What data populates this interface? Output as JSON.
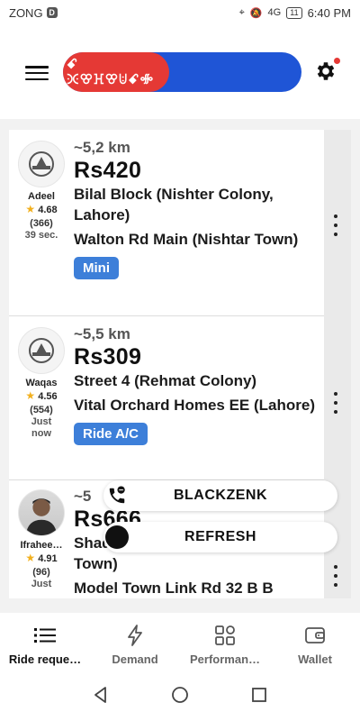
{
  "status_bar": {
    "carrier": "ZONG",
    "carrier_badge": "D",
    "network": "4G",
    "battery": "11",
    "time": "6:40 PM"
  },
  "header": {
    "status_text": "ꗃ ꖻꕢꖾꕢꖹꗃꗂ"
  },
  "rides": [
    {
      "driver_name": "Adeel",
      "rating": "4.68",
      "rating_count": "(366)",
      "time_ago": "39 sec.",
      "distance": "~5,2 km",
      "fare": "Rs420",
      "pickup": "Bilal Block (Nishter Colony, Lahore)",
      "dropoff": "Walton Rd Main (Nishtar Town)",
      "type": "Mini"
    },
    {
      "driver_name": "Waqas",
      "rating": "4.56",
      "rating_count": "(554)",
      "time_ago": "Just now",
      "distance": "~5,5 km",
      "fare": "Rs309",
      "pickup": "Street 4 (Rehmat Colony)",
      "dropoff": "Vital Orchard Homes EE (Lahore)",
      "type": "Ride A/C"
    },
    {
      "driver_name": "Ifrahee…",
      "rating": "4.91",
      "rating_count": "(96)",
      "time_ago": "Just",
      "distance": "~5",
      "fare": "Rs666",
      "pickup": "Shadab Colony Rd (Sherwani Town)",
      "dropoff": "Model Town Link Rd 32 B B"
    }
  ],
  "floating": {
    "primary_label": "BLACKZENK",
    "refresh_label": "REFRESH"
  },
  "bottom_nav": [
    {
      "label": "Ride reque…",
      "icon": "list-icon",
      "active": true
    },
    {
      "label": "Demand",
      "icon": "lightning-icon",
      "active": false
    },
    {
      "label": "Performan…",
      "icon": "grid-icon",
      "active": false
    },
    {
      "label": "Wallet",
      "icon": "wallet-icon",
      "active": false
    }
  ],
  "colors": {
    "primary_blue": "#1f55d6",
    "status_red": "#e53935",
    "badge_blue": "#3d7fd9",
    "star": "#f2b01e"
  }
}
